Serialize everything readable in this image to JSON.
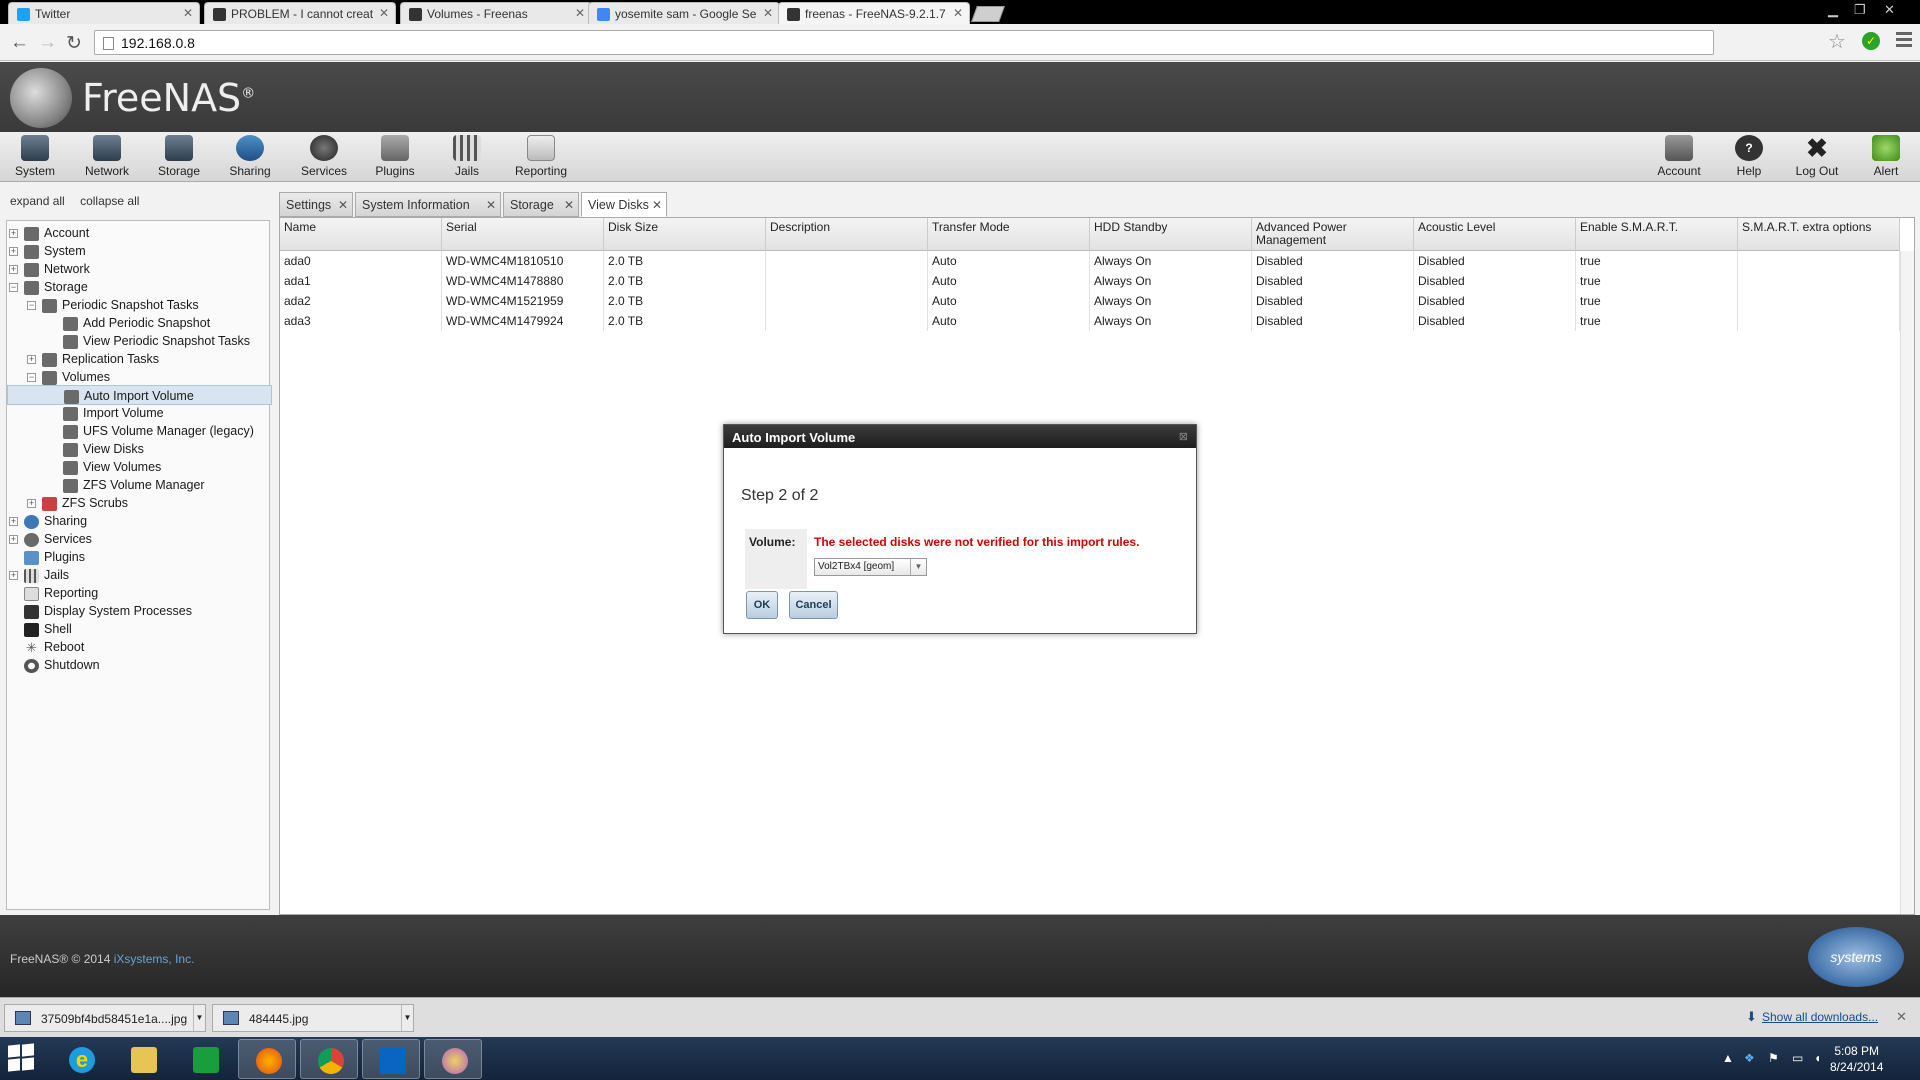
{
  "browser": {
    "tabs": [
      {
        "label": "Twitter",
        "color": "#1da1f2"
      },
      {
        "label": "PROBLEM - I cannot creat",
        "color": "#333333"
      },
      {
        "label": "Volumes - Freenas",
        "color": "#333333"
      },
      {
        "label": "yosemite sam - Google Se",
        "color": "#4285f4"
      },
      {
        "label": "freenas - FreeNAS-9.2.1.7",
        "color": "#333333"
      }
    ],
    "url": "192.168.0.8"
  },
  "app": {
    "brand": "FreeNAS",
    "brand_mark": "®"
  },
  "toolbar": {
    "left": [
      "System",
      "Network",
      "Storage",
      "Sharing",
      "Services",
      "Plugins",
      "Jails",
      "Reporting"
    ],
    "right": [
      "Account",
      "Help",
      "Log Out",
      "Alert"
    ]
  },
  "tree": {
    "expand_all": "expand all",
    "collapse_all": "collapse all",
    "items": [
      {
        "label": "Account"
      },
      {
        "label": "System"
      },
      {
        "label": "Network"
      },
      {
        "label": "Storage"
      },
      {
        "label": "Periodic Snapshot Tasks"
      },
      {
        "label": "Add Periodic Snapshot"
      },
      {
        "label": "View Periodic Snapshot Tasks"
      },
      {
        "label": "Replication Tasks"
      },
      {
        "label": "Volumes"
      },
      {
        "label": "Auto Import Volume"
      },
      {
        "label": "Import Volume"
      },
      {
        "label": "UFS Volume Manager (legacy)"
      },
      {
        "label": "View Disks"
      },
      {
        "label": "View Volumes"
      },
      {
        "label": "ZFS Volume Manager"
      },
      {
        "label": "ZFS Scrubs"
      },
      {
        "label": "Sharing"
      },
      {
        "label": "Services"
      },
      {
        "label": "Plugins"
      },
      {
        "label": "Jails"
      },
      {
        "label": "Reporting"
      },
      {
        "label": "Display System Processes"
      },
      {
        "label": "Shell"
      },
      {
        "label": "Reboot"
      },
      {
        "label": "Shutdown"
      }
    ]
  },
  "content_tabs": [
    "Settings",
    "System Information",
    "Storage",
    "View Disks"
  ],
  "disks": {
    "columns": [
      "Name",
      "Serial",
      "Disk Size",
      "Description",
      "Transfer Mode",
      "HDD Standby",
      "Advanced Power Management",
      "Acoustic Level",
      "Enable S.M.A.R.T.",
      "S.M.A.R.T. extra options"
    ],
    "rows": [
      [
        "ada0",
        "WD-WMC4M1810510",
        "2.0 TB",
        "",
        "Auto",
        "Always On",
        "Disabled",
        "Disabled",
        "true",
        ""
      ],
      [
        "ada1",
        "WD-WMC4M1478880",
        "2.0 TB",
        "",
        "Auto",
        "Always On",
        "Disabled",
        "Disabled",
        "true",
        ""
      ],
      [
        "ada2",
        "WD-WMC4M1521959",
        "2.0 TB",
        "",
        "Auto",
        "Always On",
        "Disabled",
        "Disabled",
        "true",
        ""
      ],
      [
        "ada3",
        "WD-WMC4M1479924",
        "2.0 TB",
        "",
        "Auto",
        "Always On",
        "Disabled",
        "Disabled",
        "true",
        ""
      ]
    ]
  },
  "modal": {
    "title": "Auto Import Volume",
    "close": "⊠",
    "step": "Step 2 of 2",
    "volume_label": "Volume:",
    "error": "The selected disks were not verified for this import rules.",
    "selected_volume": "Vol2TBx4 [geom]",
    "ok": "OK",
    "cancel": "Cancel"
  },
  "footer": {
    "copyright": "FreeNAS® © 2014",
    "company": "iXsystems, Inc.",
    "ix_logo": "systems"
  },
  "downloads": {
    "items": [
      "37509bf4bd58451e1a....jpg",
      "484445.jpg"
    ],
    "show_all": "Show all downloads..."
  },
  "taskbar": {
    "time": "5:08 PM",
    "date": "8/24/2014"
  }
}
